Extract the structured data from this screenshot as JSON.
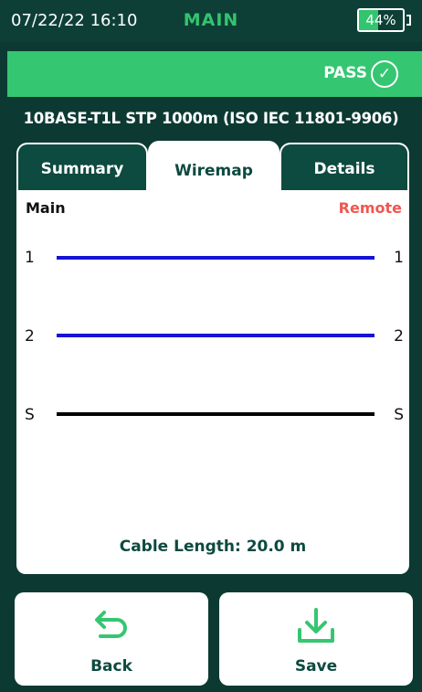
{
  "status": {
    "time": "07/22/22 16:10",
    "title": "MAIN",
    "battery": "44%",
    "battery_level": 0.44
  },
  "result": {
    "label": "PASS",
    "icon": "check-circle-icon"
  },
  "test_name": "10BASE-T1L STP 1000m (ISO IEC 11801-9906)",
  "tabs": [
    {
      "label": "Summary",
      "active": false
    },
    {
      "label": "Wiremap",
      "active": true
    },
    {
      "label": "Details",
      "active": false
    }
  ],
  "wiremap": {
    "left_label": "Main",
    "right_label": "Remote",
    "wires": [
      {
        "left": "1",
        "right": "1",
        "color": "#1414d4"
      },
      {
        "left": "2",
        "right": "2",
        "color": "#1414d4"
      },
      {
        "left": "S",
        "right": "S",
        "color": "#000000"
      }
    ],
    "cable_length": "Cable Length: 20.0 m"
  },
  "buttons": {
    "back": "Back",
    "save": "Save"
  },
  "colors": {
    "accent": "#35c672",
    "dark": "#0d4a40",
    "remote": "#f0574f"
  }
}
